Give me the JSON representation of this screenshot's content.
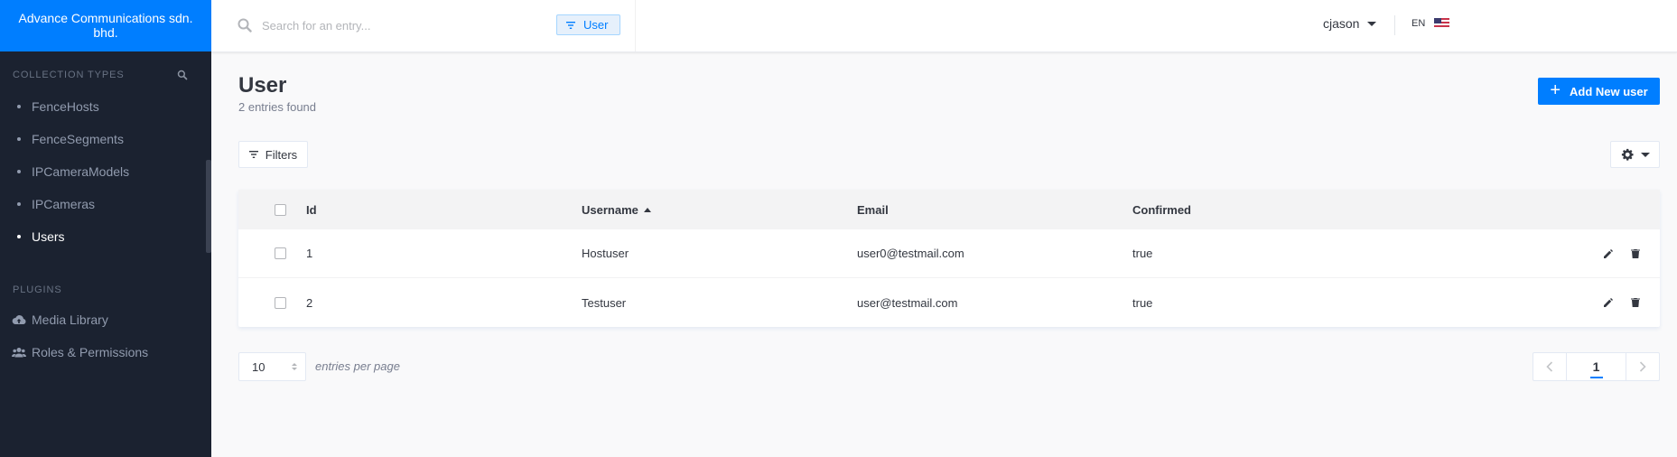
{
  "brand": {
    "name": "Advance Communications sdn. bhd."
  },
  "sidebar": {
    "collection_types_title": "COLLECTION TYPES",
    "items": [
      {
        "label": "FenceHosts"
      },
      {
        "label": "FenceSegments"
      },
      {
        "label": "IPCameraModels"
      },
      {
        "label": "IPCameras"
      },
      {
        "label": "Users",
        "active": true
      }
    ],
    "plugins_title": "PLUGINS",
    "plugins": [
      {
        "label": "Media Library",
        "icon": "cloud-upload-icon"
      },
      {
        "label": "Roles & Permissions",
        "icon": "users-icon"
      }
    ]
  },
  "header": {
    "search_placeholder": "Search for an entry...",
    "search_tag": "User",
    "username": "cjason",
    "language": "EN"
  },
  "main": {
    "title": "User",
    "subtitle": "2 entries found",
    "add_button": "Add New user",
    "filters_button": "Filters"
  },
  "table": {
    "columns": {
      "id": "Id",
      "username": "Username",
      "email": "Email",
      "confirmed": "Confirmed"
    },
    "sorted_by": "Username",
    "rows": [
      {
        "id": "1",
        "username": "Hostuser",
        "email": "user0@testmail.com",
        "confirmed": "true"
      },
      {
        "id": "2",
        "username": "Testuser",
        "email": "user@testmail.com",
        "confirmed": "true"
      }
    ]
  },
  "footer": {
    "per_page_value": "10",
    "per_page_label": "entries per page",
    "current_page": "1"
  },
  "colors": {
    "accent": "#007eff",
    "sidebar_bg": "#1b2230"
  }
}
